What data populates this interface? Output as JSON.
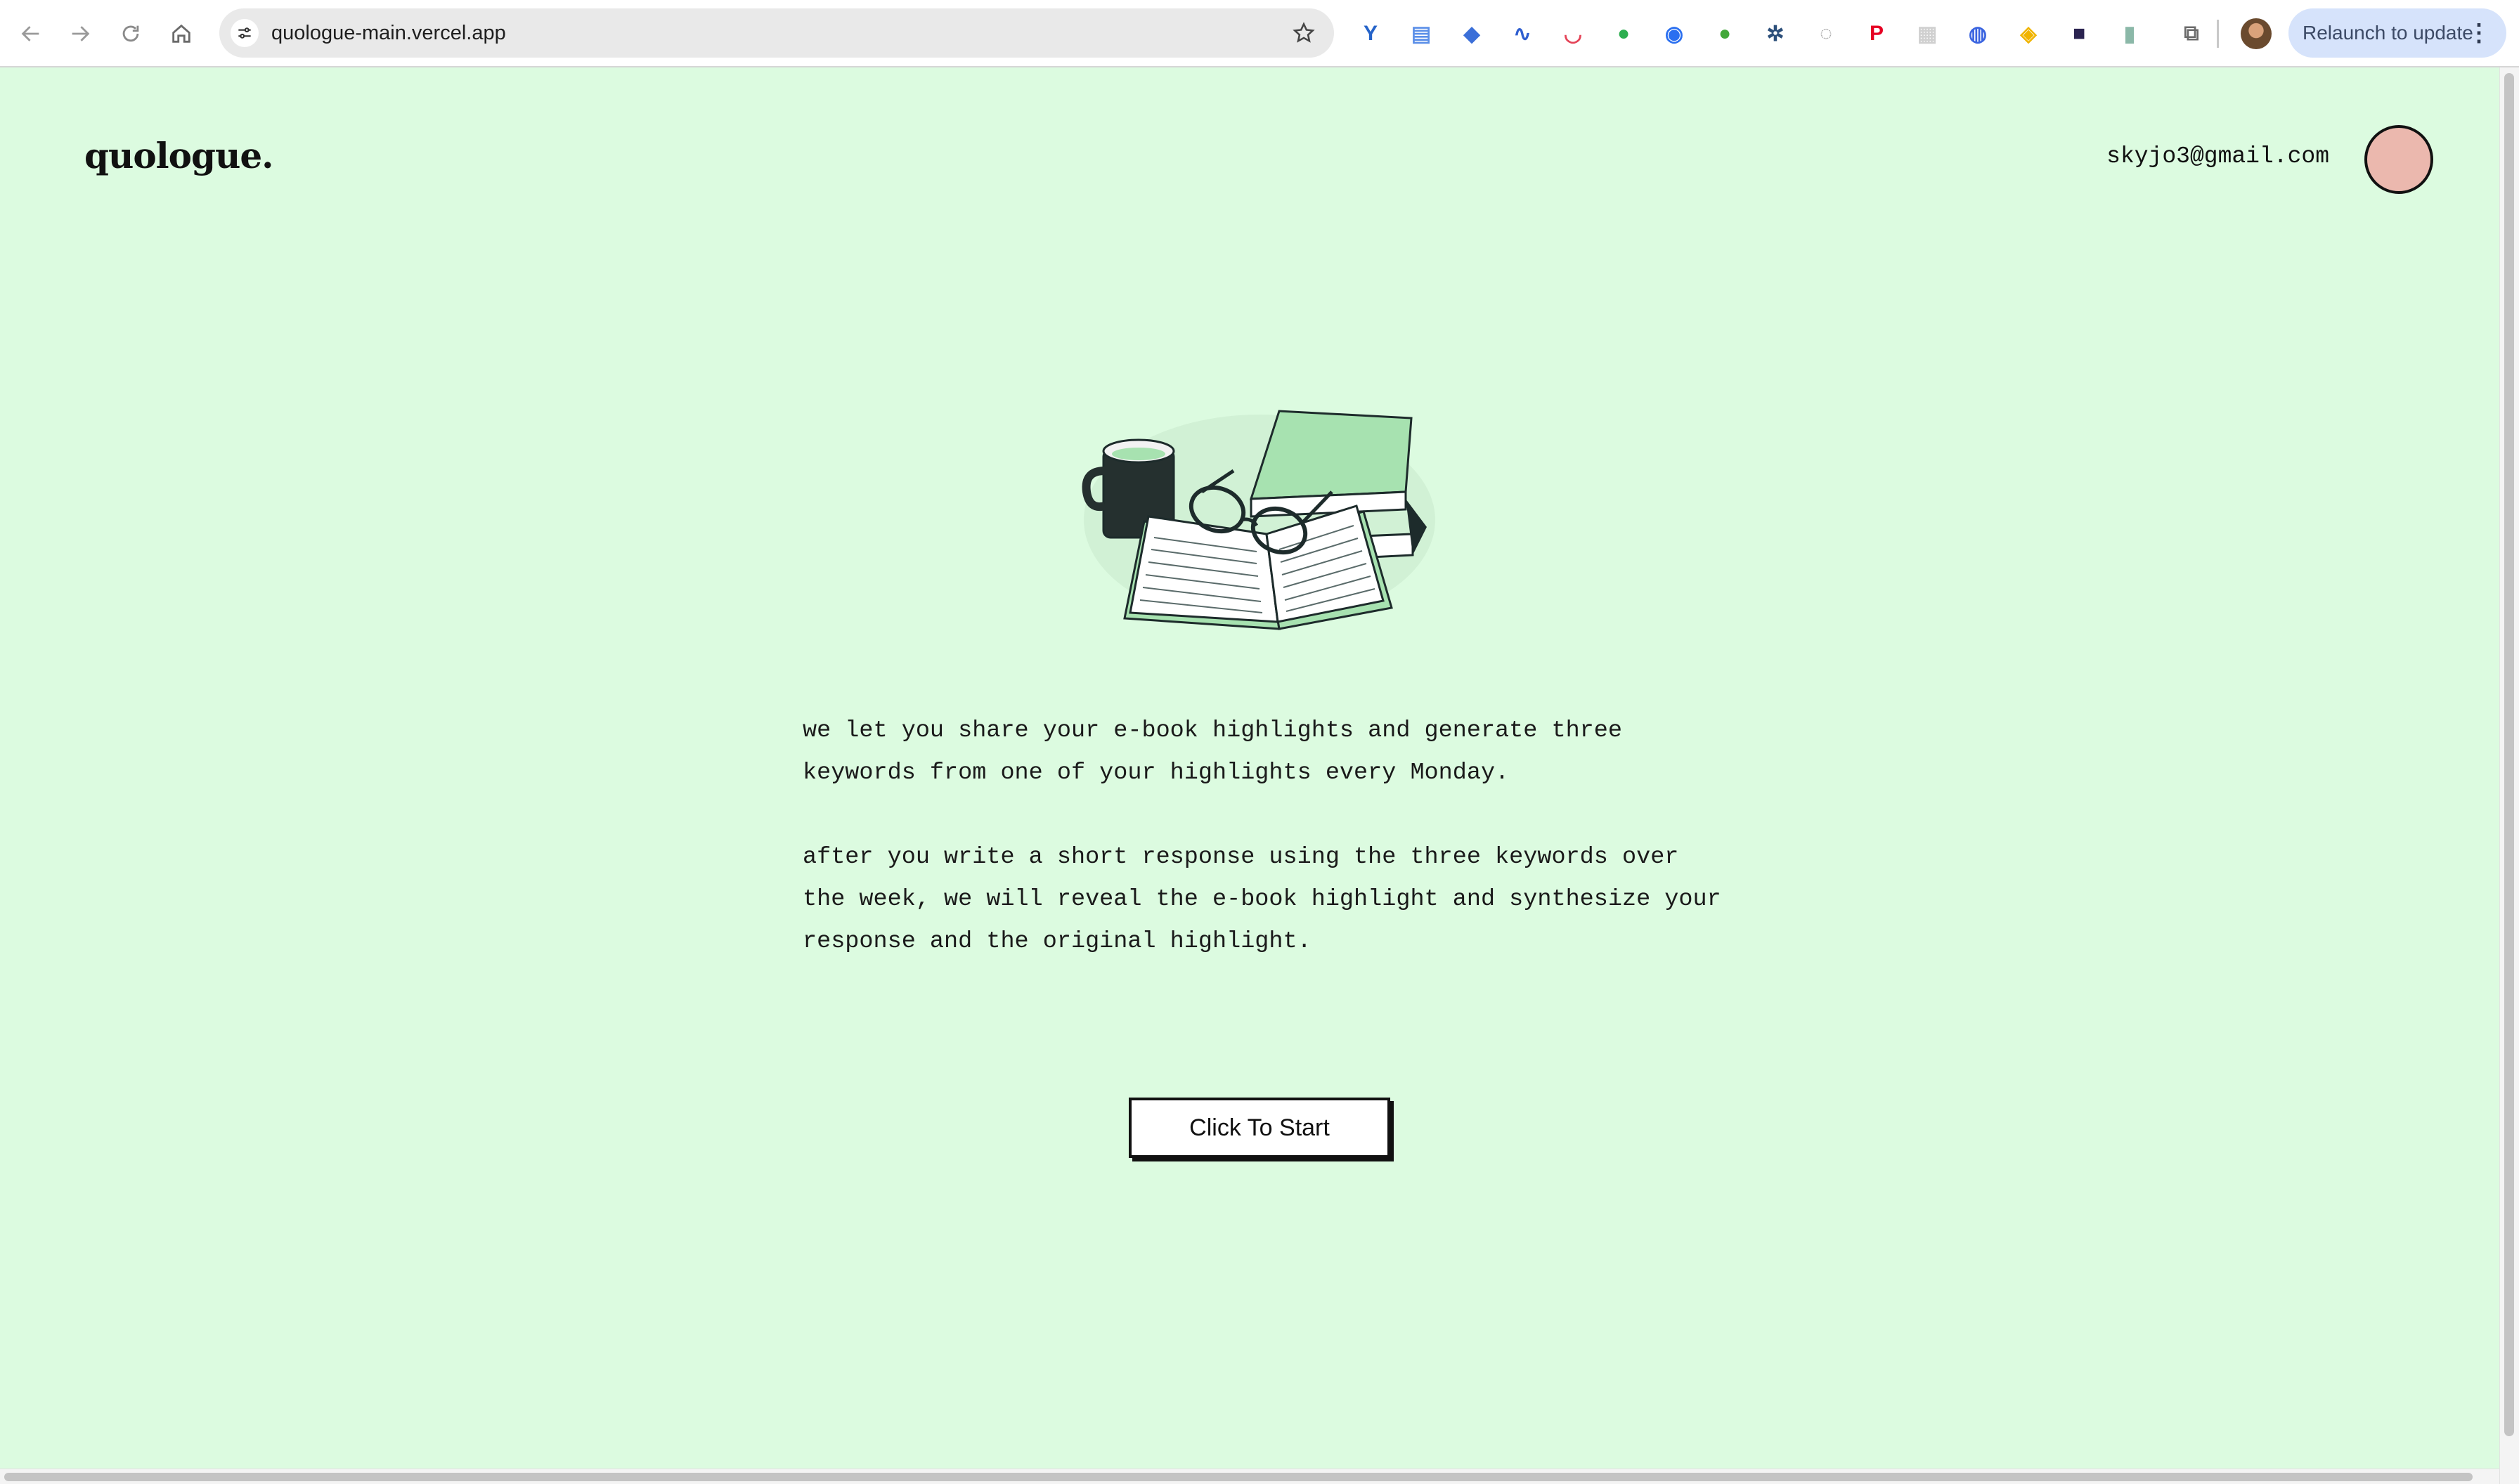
{
  "browser": {
    "url": "quologue-main.vercel.app",
    "relaunch_label": "Relaunch to update",
    "menu_glyph": "⋮",
    "nav_icons": [
      "back-arrow-icon",
      "forward-arrow-icon",
      "reload-icon",
      "home-icon"
    ],
    "extensions": [
      {
        "name": "y-extension-icon",
        "color": "#2563c9",
        "glyph": "Y"
      },
      {
        "name": "docs-extension-icon",
        "color": "#5b8fe8",
        "glyph": "▤"
      },
      {
        "name": "cap-extension-icon",
        "color": "#3b6fd8",
        "glyph": "◆"
      },
      {
        "name": "wave-extension-icon",
        "color": "#2f5fd0",
        "glyph": "∿"
      },
      {
        "name": "pocket-extension-icon",
        "color": "#e44357",
        "glyph": "◡"
      },
      {
        "name": "evernote-extension-icon",
        "color": "#2dae4f",
        "glyph": "●"
      },
      {
        "name": "globe-extension-icon",
        "color": "#2a6ff0",
        "glyph": "◉"
      },
      {
        "name": "drop-extension-icon",
        "color": "#43a83a",
        "glyph": "●"
      },
      {
        "name": "network-extension-icon",
        "color": "#2c4f7a",
        "glyph": "✲"
      },
      {
        "name": "power-extension-icon",
        "color": "#9a9a9a",
        "glyph": "◌"
      },
      {
        "name": "pinterest-extension-icon",
        "color": "#e60023",
        "glyph": "P"
      },
      {
        "name": "grid-extension-icon",
        "color": "#d0d0d0",
        "glyph": "▦"
      },
      {
        "name": "compass-extension-icon",
        "color": "#3a64e0",
        "glyph": "◍"
      },
      {
        "name": "colorwheel-extension-icon",
        "color": "#f0b400",
        "glyph": "◈"
      },
      {
        "name": "dark-square-extension-icon",
        "color": "#2a2350",
        "glyph": "■"
      },
      {
        "name": "sheet-extension-icon",
        "color": "#8bb8a8",
        "glyph": "▮"
      },
      {
        "name": "puzzle-extensions-icon",
        "color": "#6b6b6b",
        "glyph": "⧉"
      }
    ]
  },
  "header": {
    "logo": "quologue.",
    "email": "skyjo3@gmail.com"
  },
  "main": {
    "paragraph_1": "we let you share your e-book highlights and generate three keywords from one of your highlights every Monday.",
    "paragraph_2": "after you write a short response using the three keywords over the week, we will reveal the e-book highlight and synthesize your response and the original highlight.",
    "start_button": "Click To Start"
  },
  "colors": {
    "page_background": "#dcfbe0",
    "avatar_fill": "#ebb8ae",
    "book_green": "#a7e2b0"
  }
}
